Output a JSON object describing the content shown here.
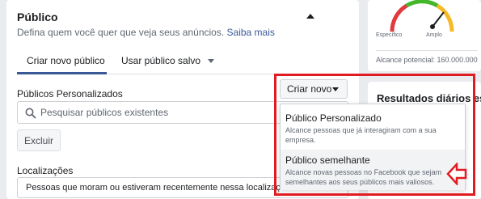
{
  "audience": {
    "title": "Público",
    "subtitle": "Defina quem você quer que veja seus anúncios.",
    "learn_more": "Saiba mais",
    "tabs": [
      {
        "label": "Criar novo público",
        "active": true
      },
      {
        "label": "Usar público salvo",
        "active": false
      }
    ]
  },
  "custom_audiences": {
    "label": "Públicos Personalizados",
    "search_placeholder": "Pesquisar públicos existentes",
    "exclude_label": "Excluir",
    "create_new_label": "Criar novo"
  },
  "dropdown": {
    "items": [
      {
        "title": "Público Personalizado",
        "desc": "Alcance pessoas que já interagiram com a sua empresa."
      },
      {
        "title": "Público semelhante",
        "desc": "Alcance novas pessoas no Facebook que sejam semelhantes aos seus públicos mais valiosos.",
        "hovered": true
      }
    ]
  },
  "locations": {
    "label": "Localizações",
    "value": "Pessoas que moram ou estiveram recentemente nessa localização"
  },
  "audience_size": {
    "specific_label": "Específico",
    "broad_label": "Amplo",
    "potential_reach": "Alcance potencial: 160.000.000"
  },
  "daily_results": {
    "title": "Resultados diários esti"
  },
  "colors": {
    "accent": "#385898",
    "highlight": "#e11b22"
  }
}
